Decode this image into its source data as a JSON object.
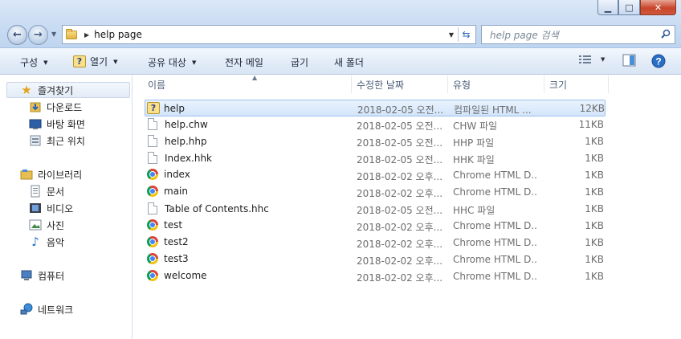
{
  "address": {
    "path": "help page",
    "search_placeholder": "help page 검색"
  },
  "window_controls": {
    "minimize": "▁",
    "maximize": "□",
    "close": "✕"
  },
  "toolbar": {
    "organize": "구성",
    "open": "열기",
    "share": "공유 대상",
    "email": "전자 메일",
    "burn": "굽기",
    "new_folder": "새 폴더"
  },
  "sidebar": {
    "favorites": "즐겨찾기",
    "downloads": "다운로드",
    "desktop": "바탕 화면",
    "recent": "최근 위치",
    "libraries": "라이브러리",
    "documents": "문서",
    "videos": "비디오",
    "pictures": "사진",
    "music": "음악",
    "computer": "컴퓨터",
    "network": "네트워크"
  },
  "columns": {
    "name": "이름",
    "date": "수정한 날짜",
    "type": "유형",
    "size": "크기"
  },
  "files": [
    {
      "name": "help",
      "date": "2018-02-05 오전...",
      "type": "컴파일된 HTML ...",
      "size": "12KB",
      "icon": "chm-help-icon"
    },
    {
      "name": "help.chw",
      "date": "2018-02-05 오전...",
      "type": "CHW 파일",
      "size": "11KB",
      "icon": "file-icon"
    },
    {
      "name": "help.hhp",
      "date": "2018-02-05 오전...",
      "type": "HHP 파일",
      "size": "1KB",
      "icon": "file-icon"
    },
    {
      "name": "Index.hhk",
      "date": "2018-02-05 오전...",
      "type": "HHK 파일",
      "size": "1KB",
      "icon": "file-icon"
    },
    {
      "name": "index",
      "date": "2018-02-02 오후...",
      "type": "Chrome HTML D...",
      "size": "1KB",
      "icon": "chrome-icon"
    },
    {
      "name": "main",
      "date": "2018-02-02 오후...",
      "type": "Chrome HTML D...",
      "size": "1KB",
      "icon": "chrome-icon"
    },
    {
      "name": "Table of Contents.hhc",
      "date": "2018-02-05 오전...",
      "type": "HHC 파일",
      "size": "1KB",
      "icon": "file-icon"
    },
    {
      "name": "test",
      "date": "2018-02-02 오후...",
      "type": "Chrome HTML D...",
      "size": "1KB",
      "icon": "chrome-icon"
    },
    {
      "name": "test2",
      "date": "2018-02-02 오후...",
      "type": "Chrome HTML D...",
      "size": "1KB",
      "icon": "chrome-icon"
    },
    {
      "name": "test3",
      "date": "2018-02-02 오후...",
      "type": "Chrome HTML D...",
      "size": "1KB",
      "icon": "chrome-icon"
    },
    {
      "name": "welcome",
      "date": "2018-02-02 오후...",
      "type": "Chrome HTML D...",
      "size": "1KB",
      "icon": "chrome-icon"
    }
  ]
}
